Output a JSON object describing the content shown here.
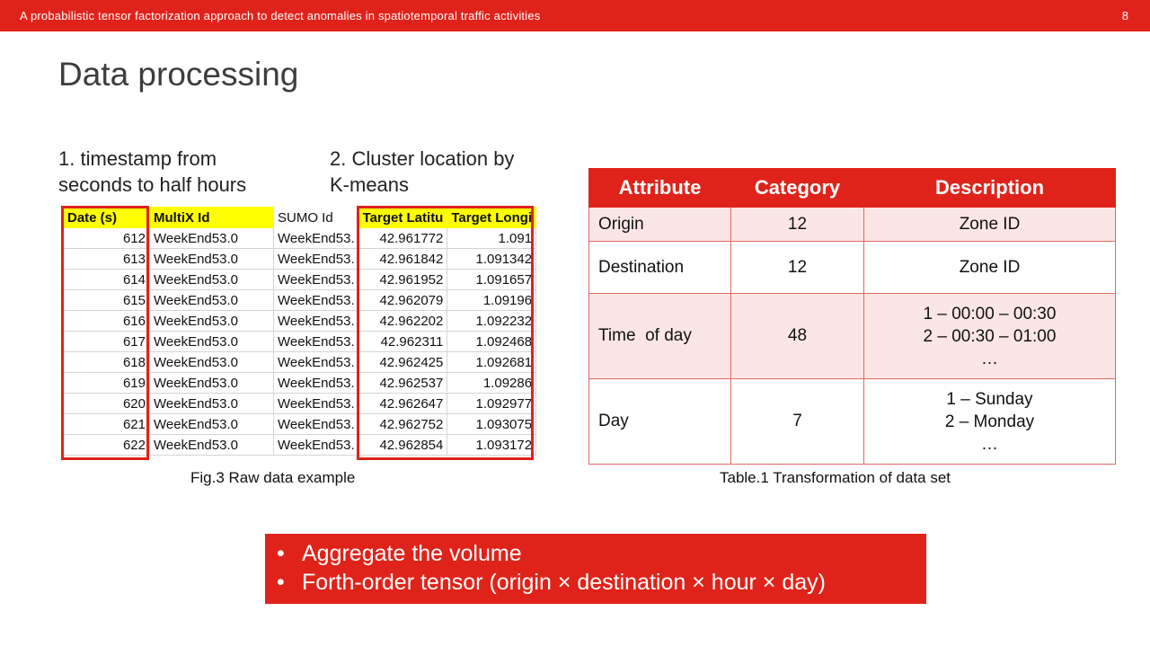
{
  "header": {
    "title": "A probabilistic tensor factorization approach to detect anomalies in spatiotemporal traffic activities",
    "page_number": "8"
  },
  "slide_title": "Data processing",
  "steps": {
    "step1": [
      "1. timestamp from",
      "seconds to half hours"
    ],
    "step2": [
      "2. Cluster location by",
      "K-means"
    ]
  },
  "raw_data": {
    "headers": [
      "Date (s)",
      "MultiX Id",
      "SUMO Id",
      "Target Latitu",
      "Target Longi"
    ],
    "rows": [
      [
        "612",
        "WeekEnd53.0",
        "WeekEnd53.",
        "42.961772",
        "1.091"
      ],
      [
        "613",
        "WeekEnd53.0",
        "WeekEnd53.",
        "42.961842",
        "1.091342"
      ],
      [
        "614",
        "WeekEnd53.0",
        "WeekEnd53.",
        "42.961952",
        "1.091657"
      ],
      [
        "615",
        "WeekEnd53.0",
        "WeekEnd53.",
        "42.962079",
        "1.09196"
      ],
      [
        "616",
        "WeekEnd53.0",
        "WeekEnd53.",
        "42.962202",
        "1.092232"
      ],
      [
        "617",
        "WeekEnd53.0",
        "WeekEnd53.",
        "42.962311",
        "1.092468"
      ],
      [
        "618",
        "WeekEnd53.0",
        "WeekEnd53.",
        "42.962425",
        "1.092681"
      ],
      [
        "619",
        "WeekEnd53.0",
        "WeekEnd53.",
        "42.962537",
        "1.09286"
      ],
      [
        "620",
        "WeekEnd53.0",
        "WeekEnd53.",
        "42.962647",
        "1.092977"
      ],
      [
        "621",
        "WeekEnd53.0",
        "WeekEnd53.",
        "42.962752",
        "1.093075"
      ],
      [
        "622",
        "WeekEnd53.0",
        "WeekEnd53.",
        "42.962854",
        "1.093172"
      ]
    ]
  },
  "fig_caption": "Fig.3 Raw data example",
  "attr_table": {
    "headers": [
      "Attribute",
      "Category",
      "Description"
    ],
    "rows": [
      {
        "attribute": "Origin",
        "category": "12",
        "description": [
          "Zone ID"
        ]
      },
      {
        "attribute": "Destination",
        "category": "12",
        "description": [
          "Zone ID"
        ]
      },
      {
        "attribute": "Time  of day",
        "category": "48",
        "description": [
          "1 – 00:00 – 00:30",
          "2 – 00:30 – 01:00",
          "…"
        ]
      },
      {
        "attribute": "Day",
        "category": "7",
        "description": [
          "1 – Sunday",
          "2 – Monday",
          "…"
        ]
      }
    ]
  },
  "table_caption": "Table.1 Transformation of data set",
  "callout": {
    "bullet": "•",
    "items": [
      "Aggregate the volume",
      "Forth-order tensor (origin × destination × hour × day)"
    ]
  },
  "colors": {
    "accent": "#e0231a",
    "highlight": "#ffff00",
    "row_tint": "#fce6e5"
  }
}
